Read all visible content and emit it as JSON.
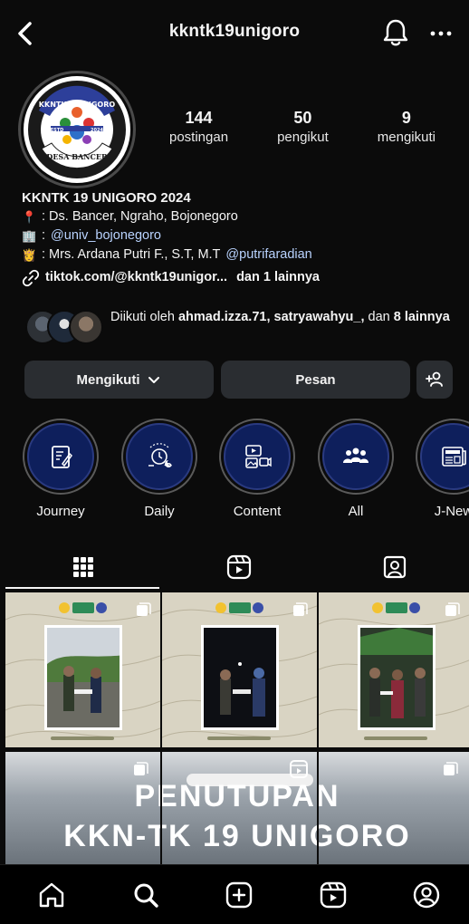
{
  "profile": {
    "handle": "kkntk19unigoro",
    "stats": [
      {
        "value": "144",
        "label": "postingan"
      },
      {
        "value": "50",
        "label": "pengikut"
      },
      {
        "value": "9",
        "label": "mengikuti"
      }
    ],
    "bio": {
      "name": "KKNTK 19 UNIGORO 2024",
      "location": ": Ds. Bancer, Ngraho, Bojonegoro",
      "univ_prefix": ":",
      "univ_handle": "@univ_bojonegoro",
      "advisor_text": ": Mrs. Ardana Putri F., S.T, M.T",
      "advisor_handle": "@putrifaradian",
      "link_text": "tiktok.com/@kkntk19unigor...",
      "link_more": "dan 1 lainnya"
    },
    "followed_by": {
      "prefix": "Diikuti oleh",
      "names": "ahmad.izza.71, satryawahyu_,",
      "mid": "dan",
      "more": "8 lainnya"
    },
    "logo": {
      "top_text": "KKNTK19UNIGORO",
      "bottom_text": "DESA BANCER",
      "left_text": "ESTD",
      "right_text": "2024"
    }
  },
  "buttons": {
    "following": "Mengikuti",
    "message": "Pesan"
  },
  "highlights": [
    {
      "label": "Journey",
      "icon": "notebook-icon"
    },
    {
      "label": "Daily",
      "icon": "clock-moon-icon"
    },
    {
      "label": "Content",
      "icon": "media-icon"
    },
    {
      "label": "All",
      "icon": "group-icon"
    },
    {
      "label": "J-New",
      "icon": "news-icon"
    }
  ],
  "banner": {
    "line1": "PENUTUPAN",
    "line2": "KKN-TK 19 UNIGORO"
  },
  "colors": {
    "background": "#0b0b0b",
    "button": "#2a2d31",
    "link": "#b9d3ff",
    "highlight_fill": "#0e1f5c"
  }
}
